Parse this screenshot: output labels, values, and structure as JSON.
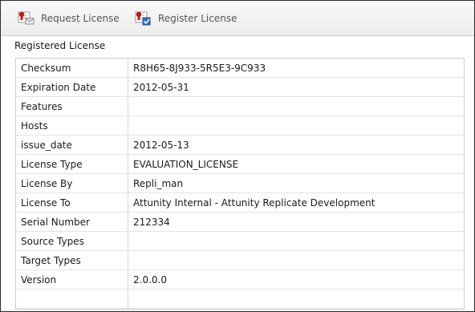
{
  "toolbar": {
    "request_label": "Request License",
    "register_label": "Register License"
  },
  "section": {
    "title": "Registered License"
  },
  "rows": [
    {
      "key": "Checksum",
      "value": "R8H65-8J933-5R5E3-9C933"
    },
    {
      "key": "Expiration Date",
      "value": "2012-05-31"
    },
    {
      "key": "Features",
      "value": ""
    },
    {
      "key": "Hosts",
      "value": ""
    },
    {
      "key": "issue_date",
      "value": "2012-05-13"
    },
    {
      "key": "License Type",
      "value": "EVALUATION_LICENSE"
    },
    {
      "key": "License By",
      "value": "Repli_man"
    },
    {
      "key": "License To",
      "value": "Attunity Internal - Attunity Replicate Development"
    },
    {
      "key": "Serial Number",
      "value": "212334"
    },
    {
      "key": "Source Types",
      "value": ""
    },
    {
      "key": "Target Types",
      "value": ""
    },
    {
      "key": "Version",
      "value": "2.0.0.0"
    }
  ],
  "colors": {
    "accent_red": "#c0191b",
    "accent_blue": "#2f6fc0"
  }
}
